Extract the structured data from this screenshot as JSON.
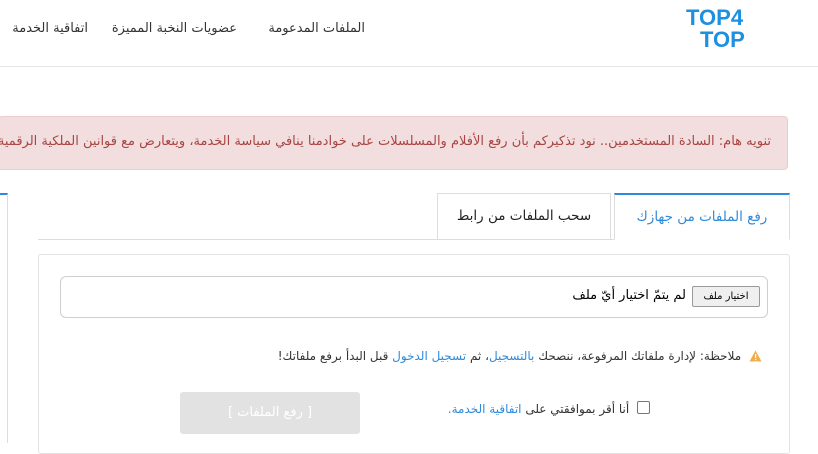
{
  "header": {
    "logo": {
      "line1": "TOP4",
      "line2": "TOP"
    },
    "nav": [
      {
        "label": "الملفات المدعومة"
      },
      {
        "label": "عضويات النخبة المميزة"
      },
      {
        "label": "اتفاقية الخدمة"
      }
    ]
  },
  "alert": {
    "text": "تنويه هام: السادة المستخدمين.. نود تذكيركم بأن رفع الأفلام والمسلسلات على خوادمنا ينافي سياسة الخدمة، ويتعارض مع قوانين الملكية الرقمية!"
  },
  "tabs": [
    {
      "label": "رفع الملفات من جهازك",
      "active": true
    },
    {
      "label": "سحب الملفات من رابط",
      "active": false
    }
  ],
  "upload": {
    "file_button": "اختيار ملف",
    "file_status": "لم يتمّ اختيار أيّ ملف",
    "note": {
      "prefix": "ملاحظة: لإدارة ملفاتك المرفوعة، ننصحك",
      "register_link": "بالتسجيل",
      "middle": "، ثم",
      "login_link": "تسجيل الدخول",
      "suffix": "قبل البدأ برفع ملفاتك!"
    },
    "agree": {
      "text": "أنا أقر بموافقتي على",
      "link": "اتفاقية الخدمة."
    },
    "submit_label": "[ رفع الملفات ]"
  },
  "colors": {
    "accent": "#2f8ad9",
    "logo_blue": "#1e90e0",
    "alert_bg": "#f2dede",
    "alert_text": "#a94442",
    "warning": "#f0ad4e"
  }
}
